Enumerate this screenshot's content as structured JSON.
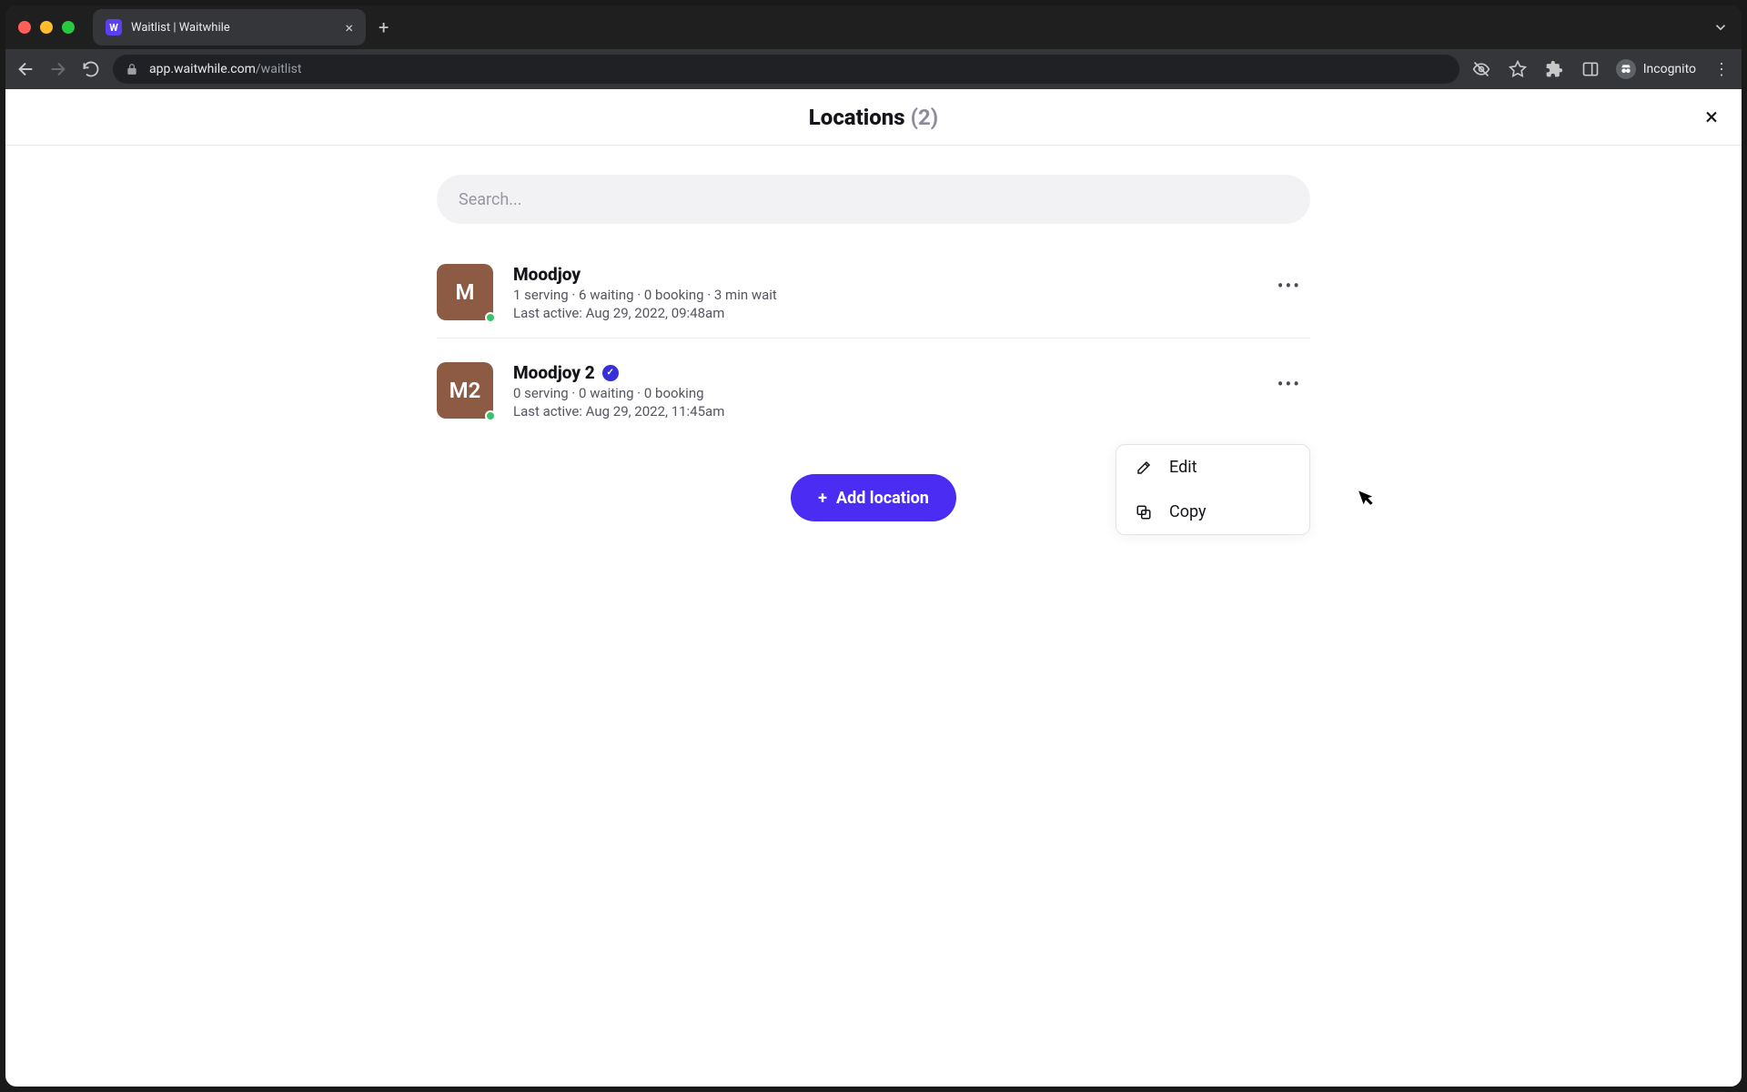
{
  "browser": {
    "tab_title": "Waitlist | Waitwhile",
    "url_host": "app.waitwhile.com",
    "url_path": "/waitlist",
    "incognito_label": "Incognito"
  },
  "header": {
    "title": "Locations",
    "count": "(2)"
  },
  "search": {
    "placeholder": "Search..."
  },
  "locations": [
    {
      "avatar": "M",
      "name": "Moodjoy",
      "verified": false,
      "meta": "1 serving · 6 waiting · 0 booking · 3 min wait",
      "last": "Last active: Aug 29, 2022, 09:48am"
    },
    {
      "avatar": "M2",
      "name": "Moodjoy 2",
      "verified": true,
      "meta": "0 serving · 0 waiting · 0 booking",
      "last": "Last active: Aug 29, 2022, 11:45am"
    }
  ],
  "add_button": "Add location",
  "popover": {
    "edit": "Edit",
    "copy": "Copy"
  },
  "colors": {
    "primary": "#4b2cf2",
    "avatar_bg": "#8d5a44",
    "verify_bg": "#3730d9",
    "status_dot": "#37c26b"
  }
}
